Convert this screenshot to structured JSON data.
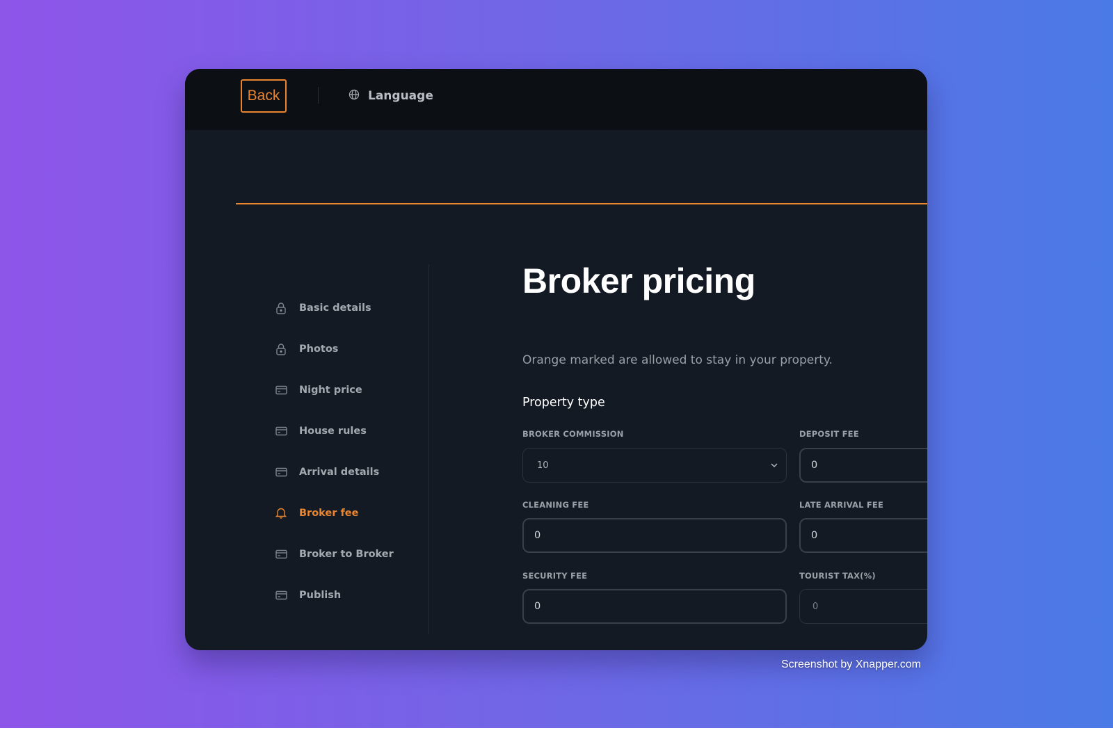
{
  "topbar": {
    "back_label": "Back",
    "language_label": "Language",
    "language_icon": "globe-icon"
  },
  "sidebar": {
    "items": [
      {
        "label": "Basic details",
        "icon": "lock-icon",
        "active": false
      },
      {
        "label": "Photos",
        "icon": "lock-icon",
        "active": false
      },
      {
        "label": "Night price",
        "icon": "card-icon",
        "active": false
      },
      {
        "label": "House rules",
        "icon": "card-icon",
        "active": false
      },
      {
        "label": "Arrival details",
        "icon": "card-icon",
        "active": false
      },
      {
        "label": "Broker fee",
        "icon": "bell-icon",
        "active": true
      },
      {
        "label": "Broker to Broker",
        "icon": "card-icon",
        "active": false
      },
      {
        "label": "Publish",
        "icon": "card-icon",
        "active": false
      }
    ]
  },
  "main": {
    "title": "Broker pricing",
    "subtitle": "Orange marked are allowed to stay in your property.",
    "section_title": "Property type",
    "fields": {
      "broker_commission": {
        "label": "BROKER COMMISSION",
        "value": "10"
      },
      "deposit_fee": {
        "label": "DEPOSIT FEE",
        "value": "0"
      },
      "cleaning_fee": {
        "label": "CLEANING FEE",
        "value": "0"
      },
      "late_arrival_fee": {
        "label": "LATE ARRIVAL FEE",
        "value": "0"
      },
      "security_fee": {
        "label": "SECURITY FEE",
        "value": "0"
      },
      "tourist_tax": {
        "label": "TOURIST TAX(%)",
        "value": "0"
      }
    }
  },
  "colors": {
    "accent": "#ea8530",
    "window_bg": "#131a23",
    "topbar_bg": "#0c0f14"
  },
  "credit": "Screenshot by Xnapper.com"
}
